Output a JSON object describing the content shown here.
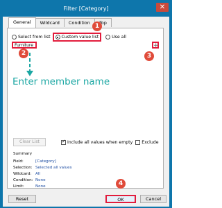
{
  "window": {
    "title": "Filter [Category]",
    "close_glyph": "✕"
  },
  "tabs": [
    {
      "label": "General",
      "active": true
    },
    {
      "label": "Wildcard",
      "active": false
    },
    {
      "label": "Condition",
      "active": false
    },
    {
      "label": "Top",
      "active": false
    }
  ],
  "general": {
    "select_from_list_label": "Select from list",
    "custom_value_list_label": "Custom value list",
    "use_all_label": "Use all",
    "selected_option": "Custom value list",
    "input_value": "Furniture",
    "add_button_glyph": "+",
    "clear_list_label": "Clear List",
    "include_all_label": "Include all values when empty",
    "include_all_checked": true,
    "exclude_label": "Exclude",
    "exclude_checked": false
  },
  "summary": {
    "heading": "Summary",
    "rows": [
      {
        "key": "Field:",
        "value": "[Category]"
      },
      {
        "key": "Selection:",
        "value": "Selected all values"
      },
      {
        "key": "Wildcard:",
        "value": "All"
      },
      {
        "key": "Condition:",
        "value": "None"
      },
      {
        "key": "Limit:",
        "value": "None"
      }
    ]
  },
  "annotations": {
    "badges": [
      "1",
      "2",
      "3",
      "4"
    ],
    "hint_text": "Enter member name",
    "badge_color": "#e04b3a",
    "highlight_color": "#e21c3c",
    "hint_color": "#1ba7a3"
  },
  "footer": {
    "reset_label": "Reset",
    "ok_label": "OK",
    "cancel_label": "Cancel"
  }
}
